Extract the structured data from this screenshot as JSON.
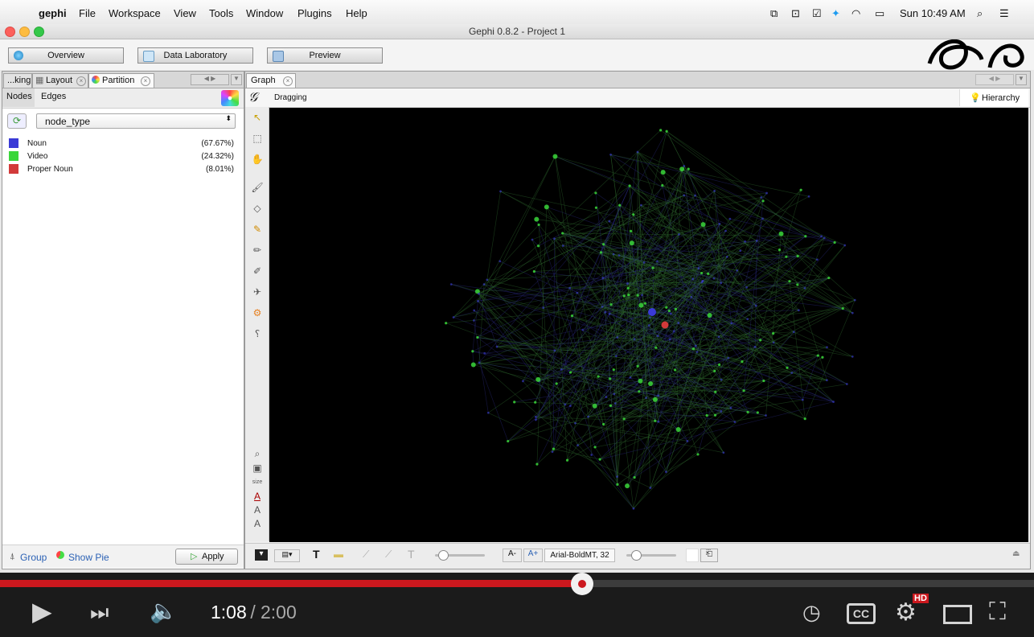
{
  "menubar": {
    "app": "gephi",
    "items": [
      "File",
      "Workspace",
      "View",
      "Tools",
      "Window",
      "Plugins",
      "Help"
    ],
    "clock": "Sun 10:49 AM"
  },
  "window": {
    "title": "Gephi 0.8.2 - Project 1"
  },
  "toolbar": {
    "overview": "Overview",
    "data_lab": "Data Laboratory",
    "preview": "Preview"
  },
  "left_panel": {
    "tabs": [
      "...king",
      "Layout",
      "Partition"
    ],
    "subtabs": [
      "Nodes",
      "Edges"
    ],
    "combo_value": "node_type",
    "legend": [
      {
        "label": "Noun",
        "pct": "(67.67%)",
        "color": "#3a3ad6"
      },
      {
        "label": "Video",
        "pct": "(24.32%)",
        "color": "#3ad63a"
      },
      {
        "label": "Proper Noun",
        "pct": "(8.01%)",
        "color": "#d23a3a"
      }
    ],
    "group": "Group",
    "show_pie": "Show Pie",
    "apply": "Apply"
  },
  "graph_panel": {
    "tab": "Graph",
    "mode": "Dragging",
    "hierarchy": "Hierarchy",
    "size_label": "size",
    "font": "Arial-BoldMT, 32",
    "colors": {
      "noun": "#3a3ad6",
      "video": "#3ad63a",
      "proper_noun": "#d23a3a"
    }
  },
  "video": {
    "current": "1:08",
    "separator": " / ",
    "duration": "2:00",
    "progress": 0.563,
    "hd_badge": "HD",
    "cc": "CC"
  }
}
